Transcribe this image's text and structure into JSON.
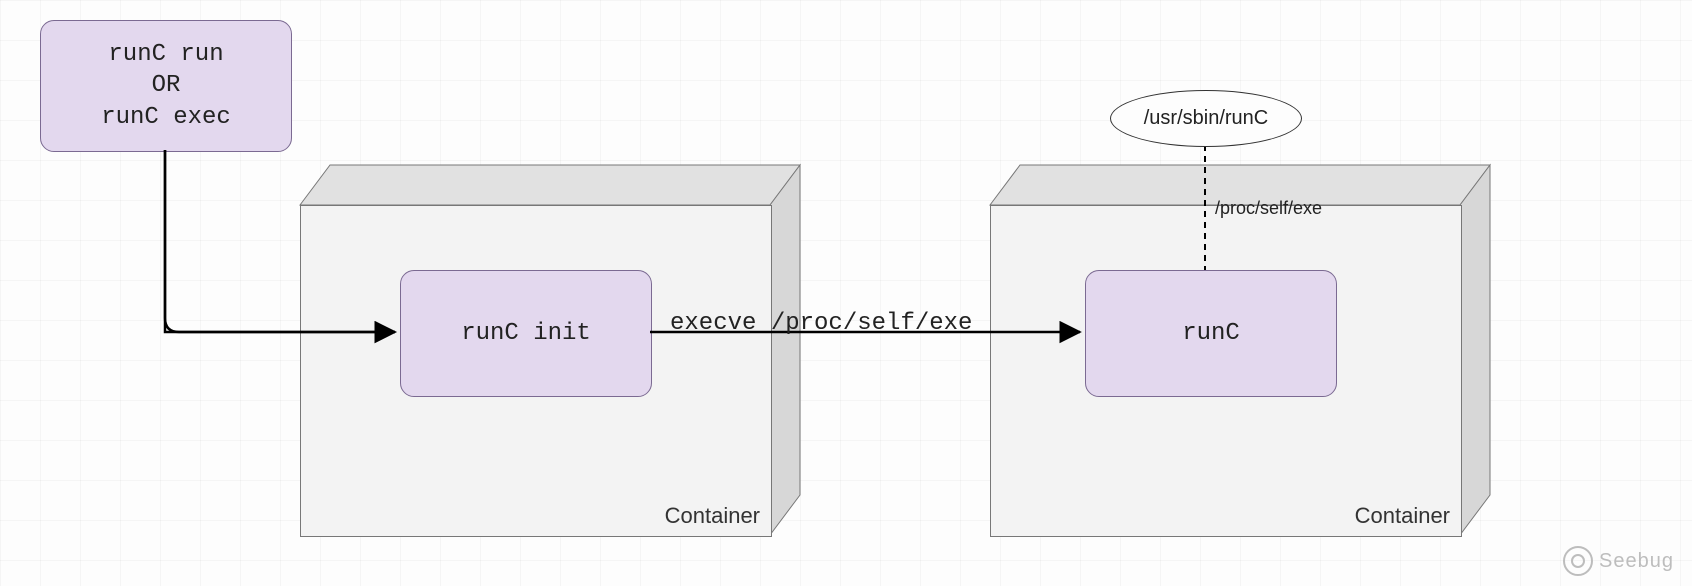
{
  "nodes": {
    "start_box": {
      "line1": "runC run",
      "line2": "OR",
      "line3": "runC exec"
    },
    "init_box": {
      "label": "runC init"
    },
    "runc_box": {
      "label": "runC"
    },
    "ellipse": {
      "label": "/usr/sbin/runC"
    }
  },
  "containers": {
    "left": {
      "label": "Container"
    },
    "right": {
      "label": "Container"
    }
  },
  "edges": {
    "start_to_init": {
      "label": ""
    },
    "init_to_runc": {
      "label": "execve /proc/self/exe"
    },
    "ellipse_to_runc": {
      "label": "/proc/self/exe"
    }
  },
  "watermark": "Seebug"
}
